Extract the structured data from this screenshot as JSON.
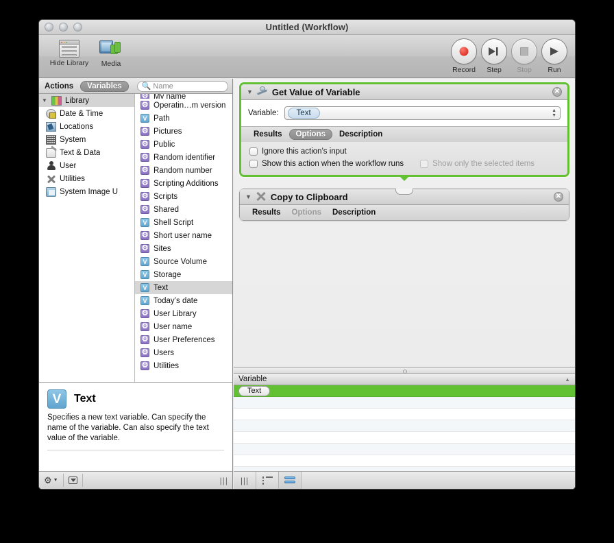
{
  "window": {
    "title": "Untitled (Workflow)"
  },
  "toolbar": {
    "hide_library_label": "Hide Library",
    "media_label": "Media",
    "record_label": "Record",
    "step_label": "Step",
    "stop_label": "Stop",
    "run_label": "Run"
  },
  "library": {
    "tab_actions": "Actions",
    "tab_variables": "Variables",
    "search_placeholder": "Name",
    "categories": [
      {
        "label": "Library",
        "icon": "library-icon"
      },
      {
        "label": "Date & Time",
        "icon": "clock-icon"
      },
      {
        "label": "Locations",
        "icon": "locations-icon"
      },
      {
        "label": "System",
        "icon": "system-icon"
      },
      {
        "label": "Text & Data",
        "icon": "text-data-icon"
      },
      {
        "label": "User",
        "icon": "user-icon"
      },
      {
        "label": "Utilities",
        "icon": "utilities-icon"
      },
      {
        "label": "System Image U",
        "icon": "folder-icon"
      }
    ],
    "variables": [
      {
        "label": "My name",
        "icon": "gear-variable-icon",
        "selected": false,
        "clipped": true
      },
      {
        "label": "Operatin…m version",
        "icon": "gear-variable-icon",
        "selected": false
      },
      {
        "label": "Path",
        "icon": "v-variable-icon",
        "selected": false
      },
      {
        "label": "Pictures",
        "icon": "gear-variable-icon",
        "selected": false
      },
      {
        "label": "Public",
        "icon": "gear-variable-icon",
        "selected": false
      },
      {
        "label": "Random identifier",
        "icon": "gear-variable-icon",
        "selected": false
      },
      {
        "label": "Random number",
        "icon": "gear-variable-icon",
        "selected": false
      },
      {
        "label": "Scripting Additions",
        "icon": "gear-variable-icon",
        "selected": false
      },
      {
        "label": "Scripts",
        "icon": "gear-variable-icon",
        "selected": false
      },
      {
        "label": "Shared",
        "icon": "gear-variable-icon",
        "selected": false
      },
      {
        "label": "Shell Script",
        "icon": "v-variable-icon",
        "selected": false
      },
      {
        "label": "Short user name",
        "icon": "gear-variable-icon",
        "selected": false
      },
      {
        "label": "Sites",
        "icon": "gear-variable-icon",
        "selected": false
      },
      {
        "label": "Source Volume",
        "icon": "v-variable-icon",
        "selected": false
      },
      {
        "label": "Storage",
        "icon": "v-variable-icon",
        "selected": false
      },
      {
        "label": "Text",
        "icon": "v-variable-icon",
        "selected": true
      },
      {
        "label": "Today’s date",
        "icon": "v-variable-icon",
        "selected": false
      },
      {
        "label": "User Library",
        "icon": "gear-variable-icon",
        "selected": false
      },
      {
        "label": "User name",
        "icon": "gear-variable-icon",
        "selected": false
      },
      {
        "label": "User Preferences",
        "icon": "gear-variable-icon",
        "selected": false
      },
      {
        "label": "Users",
        "icon": "gear-variable-icon",
        "selected": false
      },
      {
        "label": "Utilities",
        "icon": "gear-variable-icon",
        "selected": false
      }
    ]
  },
  "description": {
    "badge": "V",
    "title": "Text",
    "body": "Specifies a new text variable. Can specify the name of the variable. Can also specify the text value of the variable."
  },
  "workflow": {
    "actions": [
      {
        "title": "Get Value of Variable",
        "icon": "get-value-of-variable-icon",
        "selected": true,
        "variable_label": "Variable:",
        "variable_value": "Text",
        "tabs": [
          {
            "label": "Results",
            "state": "normal"
          },
          {
            "label": "Options",
            "state": "selected"
          },
          {
            "label": "Description",
            "state": "normal"
          }
        ],
        "options": [
          {
            "label": "Ignore this action's input",
            "checked": false,
            "disabled": false
          },
          {
            "label": "Show this action when the workflow runs",
            "checked": false,
            "disabled": false
          },
          {
            "label": "Show only the selected items",
            "checked": false,
            "disabled": true
          }
        ]
      },
      {
        "title": "Copy to Clipboard",
        "icon": "copy-to-clipboard-icon",
        "selected": false,
        "tabs": [
          {
            "label": "Results",
            "state": "normal"
          },
          {
            "label": "Options",
            "state": "disabled"
          },
          {
            "label": "Description",
            "state": "normal"
          }
        ]
      }
    ]
  },
  "variables_table": {
    "column_header": "Variable",
    "rows": [
      {
        "name": "Text",
        "selected": true
      },
      {
        "name": "",
        "selected": false
      },
      {
        "name": "",
        "selected": false
      },
      {
        "name": "",
        "selected": false
      },
      {
        "name": "",
        "selected": false
      },
      {
        "name": "",
        "selected": false
      },
      {
        "name": "",
        "selected": false
      },
      {
        "name": "",
        "selected": false
      }
    ]
  },
  "colors": {
    "selection_green": "#62c033",
    "variable_blue": "#62a8d2",
    "variable_purple": "#8a73c2",
    "record_red": "#cf1a10"
  }
}
